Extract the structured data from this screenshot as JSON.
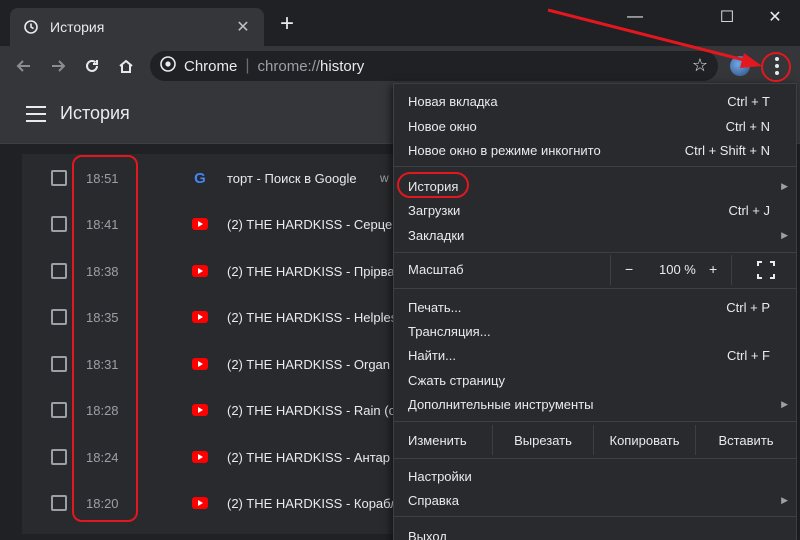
{
  "tab": {
    "title": "История",
    "new_tab_symbol": "+"
  },
  "window_controls": {
    "minimize": "—",
    "maximize": "☐",
    "close": "✕"
  },
  "omnibox": {
    "chip": "Chrome",
    "separator": "|",
    "url_prefix": "chrome://",
    "url_path": "history"
  },
  "page": {
    "title": "История"
  },
  "history": [
    {
      "time": "18:51",
      "icon": "google-icon",
      "title": "торт - Поиск в Google",
      "domain": "w"
    },
    {
      "time": "18:41",
      "icon": "youtube-icon",
      "title": "(2) THE HARDKISS - Серце",
      "domain": ""
    },
    {
      "time": "18:38",
      "icon": "youtube-icon",
      "title": "(2) THE HARDKISS - Прірва",
      "domain": ""
    },
    {
      "time": "18:35",
      "icon": "youtube-icon",
      "title": "(2) THE HARDKISS - Helpless",
      "domain": ""
    },
    {
      "time": "18:31",
      "icon": "youtube-icon",
      "title": "(2) THE HARDKISS - Organ",
      "domain": ""
    },
    {
      "time": "18:28",
      "icon": "youtube-icon",
      "title": "(2) THE HARDKISS - Rain (c",
      "domain": ""
    },
    {
      "time": "18:24",
      "icon": "youtube-icon",
      "title": "(2) THE HARDKISS - Антар",
      "domain": ""
    },
    {
      "time": "18:20",
      "icon": "youtube-icon",
      "title": "(2) THE HARDKISS - Корабл",
      "domain": ""
    }
  ],
  "menu": {
    "new_tab": {
      "label": "Новая вкладка",
      "shortcut": "Ctrl + T"
    },
    "new_window": {
      "label": "Новое окно",
      "shortcut": "Ctrl + N"
    },
    "incognito": {
      "label": "Новое окно в режиме инкогнито",
      "shortcut": "Ctrl + Shift + N"
    },
    "history": {
      "label": "История"
    },
    "downloads": {
      "label": "Загрузки",
      "shortcut": "Ctrl + J"
    },
    "bookmarks": {
      "label": "Закладки"
    },
    "zoom": {
      "label": "Масштаб",
      "minus": "−",
      "value": "100 %",
      "plus": "+"
    },
    "print": {
      "label": "Печать...",
      "shortcut": "Ctrl + P"
    },
    "cast": {
      "label": "Трансляция..."
    },
    "find": {
      "label": "Найти...",
      "shortcut": "Ctrl + F"
    },
    "zoom_page": {
      "label": "Сжать страницу"
    },
    "more_tools": {
      "label": "Дополнительные инструменты"
    },
    "edit": {
      "label": "Изменить",
      "cut": "Вырезать",
      "copy": "Копировать",
      "paste": "Вставить"
    },
    "settings": {
      "label": "Настройки"
    },
    "help": {
      "label": "Справка"
    },
    "exit": {
      "label": "Выход"
    }
  },
  "colors": {
    "annotation_red": "#e3171e",
    "menu_bg": "#292a2d",
    "toolbar_bg": "#35363a"
  }
}
